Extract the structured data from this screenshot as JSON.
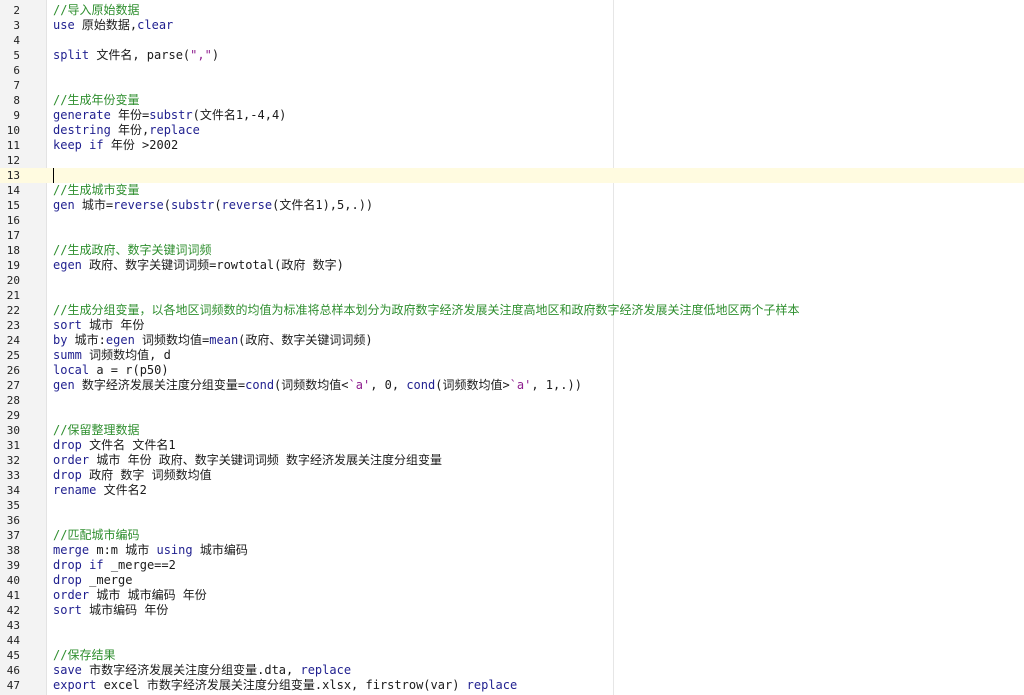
{
  "editor": {
    "current_line": 13,
    "colors": {
      "comment": "#2f8f2f",
      "keyword": "#1f1f8f",
      "string": "#8f1f8f",
      "plain": "#1a1a1a",
      "current_line_bg": "#fffbe0",
      "gutter_bg": "#f3f3f3"
    },
    "lines": [
      {
        "n": "2",
        "tokens": [
          {
            "t": "comment",
            "v": "//导入原始数据"
          }
        ]
      },
      {
        "n": "3",
        "tokens": [
          {
            "t": "keyword",
            "v": "use"
          },
          {
            "t": "plain",
            "v": " 原始数据,"
          },
          {
            "t": "keyword",
            "v": "clear"
          }
        ]
      },
      {
        "n": "4",
        "tokens": []
      },
      {
        "n": "5",
        "tokens": [
          {
            "t": "keyword",
            "v": "split"
          },
          {
            "t": "plain",
            "v": " 文件名, parse("
          },
          {
            "t": "string",
            "v": "\",\""
          },
          {
            "t": "plain",
            "v": ")"
          }
        ]
      },
      {
        "n": "6",
        "tokens": []
      },
      {
        "n": "7",
        "tokens": []
      },
      {
        "n": "8",
        "tokens": [
          {
            "t": "comment",
            "v": "//生成年份变量"
          }
        ]
      },
      {
        "n": "9",
        "tokens": [
          {
            "t": "keyword",
            "v": "generate"
          },
          {
            "t": "plain",
            "v": " 年份="
          },
          {
            "t": "function",
            "v": "substr"
          },
          {
            "t": "plain",
            "v": "(文件名1,-4,4)"
          }
        ]
      },
      {
        "n": "10",
        "tokens": [
          {
            "t": "keyword",
            "v": "destring"
          },
          {
            "t": "plain",
            "v": " 年份,"
          },
          {
            "t": "keyword",
            "v": "replace"
          }
        ]
      },
      {
        "n": "11",
        "tokens": [
          {
            "t": "keyword",
            "v": "keep"
          },
          {
            "t": "plain",
            "v": " "
          },
          {
            "t": "keyword",
            "v": "if"
          },
          {
            "t": "plain",
            "v": " 年份 >2002"
          }
        ]
      },
      {
        "n": "12",
        "tokens": []
      },
      {
        "n": "13",
        "tokens": []
      },
      {
        "n": "14",
        "tokens": [
          {
            "t": "comment",
            "v": "//生成城市变量"
          }
        ]
      },
      {
        "n": "15",
        "tokens": [
          {
            "t": "keyword",
            "v": "gen"
          },
          {
            "t": "plain",
            "v": " 城市="
          },
          {
            "t": "function",
            "v": "reverse"
          },
          {
            "t": "plain",
            "v": "("
          },
          {
            "t": "function",
            "v": "substr"
          },
          {
            "t": "plain",
            "v": "("
          },
          {
            "t": "function",
            "v": "reverse"
          },
          {
            "t": "plain",
            "v": "(文件名1),5,.))"
          }
        ]
      },
      {
        "n": "16",
        "tokens": []
      },
      {
        "n": "17",
        "tokens": []
      },
      {
        "n": "18",
        "tokens": [
          {
            "t": "comment",
            "v": "//生成政府、数字关键词词频"
          }
        ]
      },
      {
        "n": "19",
        "tokens": [
          {
            "t": "keyword",
            "v": "egen"
          },
          {
            "t": "plain",
            "v": " 政府、数字关键词词频=rowtotal(政府 数字)"
          }
        ]
      },
      {
        "n": "20",
        "tokens": []
      },
      {
        "n": "21",
        "tokens": []
      },
      {
        "n": "22",
        "tokens": [
          {
            "t": "comment",
            "v": "//生成分组变量，以各地区词频数的均值为标准将总样本划分为政府数字经济发展关注度高地区和政府数字经济发展关注度低地区两个子样本"
          }
        ]
      },
      {
        "n": "23",
        "tokens": [
          {
            "t": "keyword",
            "v": "sort"
          },
          {
            "t": "plain",
            "v": " 城市 年份"
          }
        ]
      },
      {
        "n": "24",
        "tokens": [
          {
            "t": "keyword",
            "v": "by"
          },
          {
            "t": "plain",
            "v": " 城市:"
          },
          {
            "t": "keyword",
            "v": "egen"
          },
          {
            "t": "plain",
            "v": " 词频数均值="
          },
          {
            "t": "function",
            "v": "mean"
          },
          {
            "t": "plain",
            "v": "(政府、数字关键词词频)"
          }
        ]
      },
      {
        "n": "25",
        "tokens": [
          {
            "t": "keyword",
            "v": "summ"
          },
          {
            "t": "plain",
            "v": " 词频数均值, d"
          }
        ]
      },
      {
        "n": "26",
        "tokens": [
          {
            "t": "keyword",
            "v": "local"
          },
          {
            "t": "plain",
            "v": " a = r(p50)"
          }
        ]
      },
      {
        "n": "27",
        "tokens": [
          {
            "t": "keyword",
            "v": "gen"
          },
          {
            "t": "plain",
            "v": " 数字经济发展关注度分组变量="
          },
          {
            "t": "function",
            "v": "cond"
          },
          {
            "t": "plain",
            "v": "(词频数均值<"
          },
          {
            "t": "string",
            "v": "`a'"
          },
          {
            "t": "plain",
            "v": ", 0, "
          },
          {
            "t": "function",
            "v": "cond"
          },
          {
            "t": "plain",
            "v": "(词频数均值>"
          },
          {
            "t": "string",
            "v": "`a'"
          },
          {
            "t": "plain",
            "v": ", 1,.))"
          }
        ]
      },
      {
        "n": "28",
        "tokens": []
      },
      {
        "n": "29",
        "tokens": []
      },
      {
        "n": "30",
        "tokens": [
          {
            "t": "comment",
            "v": "//保留整理数据"
          }
        ]
      },
      {
        "n": "31",
        "tokens": [
          {
            "t": "keyword",
            "v": "drop"
          },
          {
            "t": "plain",
            "v": " 文件名 文件名1"
          }
        ]
      },
      {
        "n": "32",
        "tokens": [
          {
            "t": "keyword",
            "v": "order"
          },
          {
            "t": "plain",
            "v": " 城市 年份 政府、数字关键词词频 数字经济发展关注度分组变量"
          }
        ]
      },
      {
        "n": "33",
        "tokens": [
          {
            "t": "keyword",
            "v": "drop"
          },
          {
            "t": "plain",
            "v": " 政府 数字 词频数均值"
          }
        ]
      },
      {
        "n": "34",
        "tokens": [
          {
            "t": "keyword",
            "v": "rename"
          },
          {
            "t": "plain",
            "v": " 文件名2"
          }
        ]
      },
      {
        "n": "35",
        "tokens": []
      },
      {
        "n": "36",
        "tokens": []
      },
      {
        "n": "37",
        "tokens": [
          {
            "t": "comment",
            "v": "//匹配城市编码"
          }
        ]
      },
      {
        "n": "38",
        "tokens": [
          {
            "t": "keyword",
            "v": "merge"
          },
          {
            "t": "plain",
            "v": " m:m 城市 "
          },
          {
            "t": "keyword",
            "v": "using"
          },
          {
            "t": "plain",
            "v": " 城市编码"
          }
        ]
      },
      {
        "n": "39",
        "tokens": [
          {
            "t": "keyword",
            "v": "drop"
          },
          {
            "t": "plain",
            "v": " "
          },
          {
            "t": "keyword",
            "v": "if"
          },
          {
            "t": "plain",
            "v": " _merge==2"
          }
        ]
      },
      {
        "n": "40",
        "tokens": [
          {
            "t": "keyword",
            "v": "drop"
          },
          {
            "t": "plain",
            "v": " _merge"
          }
        ]
      },
      {
        "n": "41",
        "tokens": [
          {
            "t": "keyword",
            "v": "order"
          },
          {
            "t": "plain",
            "v": " 城市 城市编码 年份"
          }
        ]
      },
      {
        "n": "42",
        "tokens": [
          {
            "t": "keyword",
            "v": "sort"
          },
          {
            "t": "plain",
            "v": " 城市编码 年份"
          }
        ]
      },
      {
        "n": "43",
        "tokens": []
      },
      {
        "n": "44",
        "tokens": []
      },
      {
        "n": "45",
        "tokens": [
          {
            "t": "comment",
            "v": "//保存结果"
          }
        ]
      },
      {
        "n": "46",
        "tokens": [
          {
            "t": "keyword",
            "v": "save"
          },
          {
            "t": "plain",
            "v": " 市数字经济发展关注度分组变量.dta, "
          },
          {
            "t": "keyword",
            "v": "replace"
          }
        ]
      },
      {
        "n": "47",
        "tokens": [
          {
            "t": "keyword",
            "v": "export"
          },
          {
            "t": "plain",
            "v": " excel 市数字经济发展关注度分组变量.xlsx, firstrow(var) "
          },
          {
            "t": "keyword",
            "v": "replace"
          }
        ]
      }
    ]
  }
}
